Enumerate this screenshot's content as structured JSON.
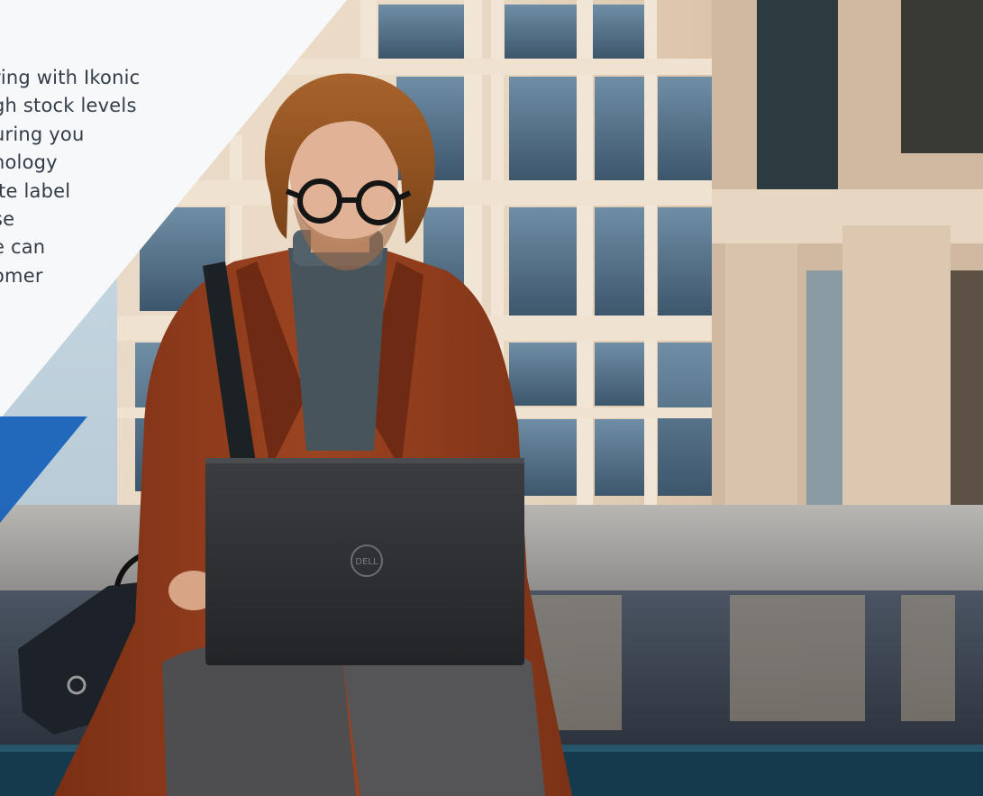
{
  "hero": {
    "intro_lines": [
      "ring with Ikonic",
      "gh stock levels",
      "uring you",
      "nology",
      "ite label",
      "se",
      "e can",
      "omer"
    ],
    "brand_logo_text": "DELL"
  },
  "colors": {
    "panel_white": "#f7f8fa",
    "accent_blue": "#1560b8",
    "text_dark": "#333d47",
    "coat": "#8a3b1c"
  }
}
